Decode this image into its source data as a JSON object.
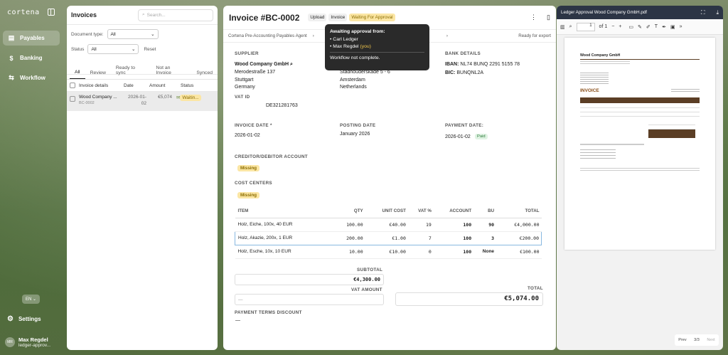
{
  "app": {
    "brand": "cortena"
  },
  "sidebar": {
    "items": [
      {
        "label": "Payables",
        "icon": "document-icon"
      },
      {
        "label": "Banking",
        "icon": "dollar-icon"
      },
      {
        "label": "Workflow",
        "icon": "workflow-icon"
      }
    ],
    "language": "EN",
    "settings_label": "Settings",
    "user": {
      "initials": "MR",
      "name": "Max Regdel",
      "email": "ledger-approv..."
    }
  },
  "list": {
    "title": "Invoices",
    "search_placeholder": "Search...",
    "doc_type_label": "Document type:",
    "doc_type_value": "All",
    "status_label": "Status",
    "status_value": "All",
    "reset_label": "Reset",
    "tabs": [
      "All",
      "Review",
      "Ready to sync",
      "Not an Invoice",
      "Synced"
    ],
    "columns": [
      "Invoice details",
      "Date",
      "Amount",
      "Status"
    ],
    "rows": [
      {
        "name": "Wood Company ...",
        "id": "BC-0002",
        "date_a": "2026-01-",
        "date_b": "02",
        "amount": "€5,074",
        "status": "Waitin..."
      }
    ]
  },
  "detail": {
    "title": "Invoice #BC-0002",
    "tags": [
      "Upload",
      "Invoice",
      "Waiting For Approval"
    ],
    "step_agent": "Cortena Pre-Accounting Payables Agent",
    "step_ready": "Ready for export",
    "tooltip": {
      "title": "Awaiting approval from:",
      "approvers": [
        {
          "name": "Carl Ledger",
          "you": ""
        },
        {
          "name": "Max Regdel",
          "you": "(you)"
        }
      ],
      "note": "Workflow not complete."
    },
    "supplier": {
      "label": "SUPPLIER",
      "name": "Wood Company GmbH",
      "street": "Merodestraße 137",
      "city": "Stuttgart",
      "country": "Germany",
      "vat_label": "VAT ID",
      "vat_value": "DE321281763"
    },
    "recipient": {
      "street": "Stadhouderskade 5 - 6",
      "city": "Amsterdam",
      "country": "Netherlands"
    },
    "bank": {
      "label": "BANK DETAILS",
      "iban_label": "IBAN:",
      "iban": "NL74 BUNQ 2291 5155 78",
      "bic_label": "BIC:",
      "bic": "BUNQNL2A"
    },
    "invoice_date_label": "INVOICE DATE *",
    "invoice_date": "2026-01-02",
    "posting_date_label": "POSTING DATE",
    "posting_date": "January 2026",
    "payment_date_label": "PAYMENT DATE:",
    "payment_date": "2026-01-02",
    "paid_label": "Paid",
    "creditor_label": "CREDITOR/DEBITOR ACCOUNT",
    "missing_label": "Missing",
    "cost_centers_label": "COST CENTERS",
    "items": {
      "headers": [
        "ITEM",
        "QTY",
        "UNIT COST",
        "VAT %",
        "ACCOUNT",
        "BU",
        "TOTAL"
      ],
      "rows": [
        [
          "Holz, Eiche, 100x, 40 EUR",
          "100.00",
          "€40.00",
          "19",
          "100",
          "90",
          "€4,000.00"
        ],
        [
          "Holz, Akazie, 200x, 1 EUR",
          "200.00",
          "€1.00",
          "7",
          "100",
          "3",
          "€200.00"
        ],
        [
          "Holz, Esche, 10x, 10 EUR",
          "10.00",
          "€10.00",
          "0",
          "100",
          "None",
          "€100.00"
        ]
      ]
    },
    "subtotal_label": "SUBTOTAL",
    "subtotal": "€4,300.00",
    "vat_amount_label": "VAT AMOUNT",
    "vat_amount": "—",
    "total_label": "TOTAL",
    "total": "€5,074.00",
    "discount_label": "PAYMENT TERMS DISCOUNT",
    "discount": "—"
  },
  "pdf": {
    "filename": "Ledger Approval Wood Company GmbH.pdf",
    "page": "1",
    "of": "of 1",
    "company": "Wood Company GmbH",
    "doc_title": "INVOICE",
    "prev": "Prev",
    "pages": "3/3",
    "next": "Next"
  },
  "colors": {
    "accent_wait": "#fbe6a4",
    "pdf_header": "#2c3545",
    "pdf_brown": "#5b3e25"
  }
}
